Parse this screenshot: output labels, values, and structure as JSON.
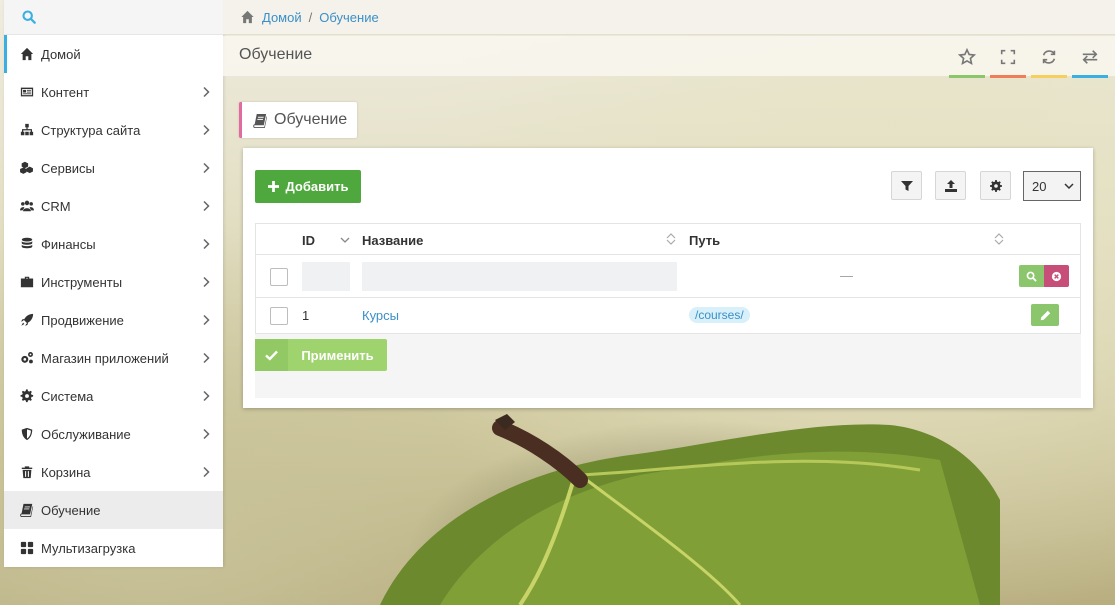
{
  "breadcrumb": {
    "home": "Домой",
    "separator": "/",
    "current": "Обучение"
  },
  "page": {
    "title": "Обучение",
    "section_label": "Обучение"
  },
  "sidebar": {
    "items": [
      {
        "label": "Домой",
        "icon": "home-icon"
      },
      {
        "label": "Контент",
        "icon": "newspaper-icon"
      },
      {
        "label": "Структура сайта",
        "icon": "sitemap-icon"
      },
      {
        "label": "Сервисы",
        "icon": "cubes-icon"
      },
      {
        "label": "CRM",
        "icon": "users-icon"
      },
      {
        "label": "Финансы",
        "icon": "database-icon"
      },
      {
        "label": "Инструменты",
        "icon": "briefcase-icon"
      },
      {
        "label": "Продвижение",
        "icon": "rocket-icon"
      },
      {
        "label": "Магазин приложений",
        "icon": "cogs-icon"
      },
      {
        "label": "Система",
        "icon": "gear-icon"
      },
      {
        "label": "Обслуживание",
        "icon": "shield-icon"
      },
      {
        "label": "Корзина",
        "icon": "trash-icon"
      },
      {
        "label": "Обучение",
        "icon": "book-icon"
      },
      {
        "label": "Мультизагрузка",
        "icon": "grid-icon"
      }
    ]
  },
  "toolbar": {
    "add_label": "Добавить",
    "page_size": "20",
    "apply_label": "Применить"
  },
  "grid": {
    "columns": {
      "id": "ID",
      "name": "Название",
      "path": "Путь"
    },
    "filter_placeholder": "—",
    "rows": [
      {
        "id": "1",
        "name": "Курсы",
        "path": "/courses/"
      }
    ]
  },
  "colors": {
    "accent_blue": "#3ab0e2",
    "green": "#4fa83d",
    "pink": "#e36aa1",
    "header_bars": [
      "#8bc66c",
      "#f07d5a",
      "#f6cf5e",
      "#3ab0e2"
    ]
  }
}
